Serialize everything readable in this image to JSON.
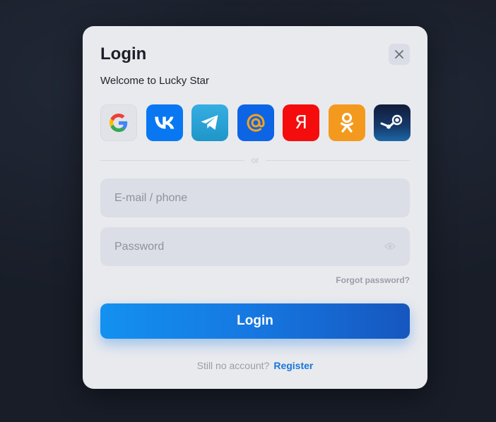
{
  "modal": {
    "title": "Login",
    "subtitle": "Welcome to Lucky Star",
    "close_icon": "close-icon"
  },
  "socials": [
    {
      "name": "google",
      "icon": "google-icon",
      "color": "#e1e3e8"
    },
    {
      "name": "vk",
      "icon": "vk-icon",
      "color": "#0a77f2"
    },
    {
      "name": "telegram",
      "icon": "telegram-icon",
      "color": "#2aa3d8"
    },
    {
      "name": "mail-ru",
      "icon": "at-sign-icon",
      "color": "#0d65e6"
    },
    {
      "name": "yandex",
      "icon": "yandex-icon",
      "glyph": "Я",
      "color": "#f50c0c"
    },
    {
      "name": "odnoklassniki",
      "icon": "odnoklassniki-icon",
      "color": "#f39a1e"
    },
    {
      "name": "steam",
      "icon": "steam-icon",
      "color": "#163a6a"
    }
  ],
  "divider": {
    "text": "or"
  },
  "form": {
    "email_placeholder": "E-mail / phone",
    "email_value": "",
    "password_placeholder": "Password",
    "password_value": "",
    "forgot_label": "Forgot password?",
    "submit_label": "Login"
  },
  "footer": {
    "question": "Still no account?",
    "register_label": "Register"
  },
  "colors": {
    "accent": "#1677e0",
    "background": "#181d28",
    "modal": "#e9eaee",
    "link": "#1877d8"
  }
}
